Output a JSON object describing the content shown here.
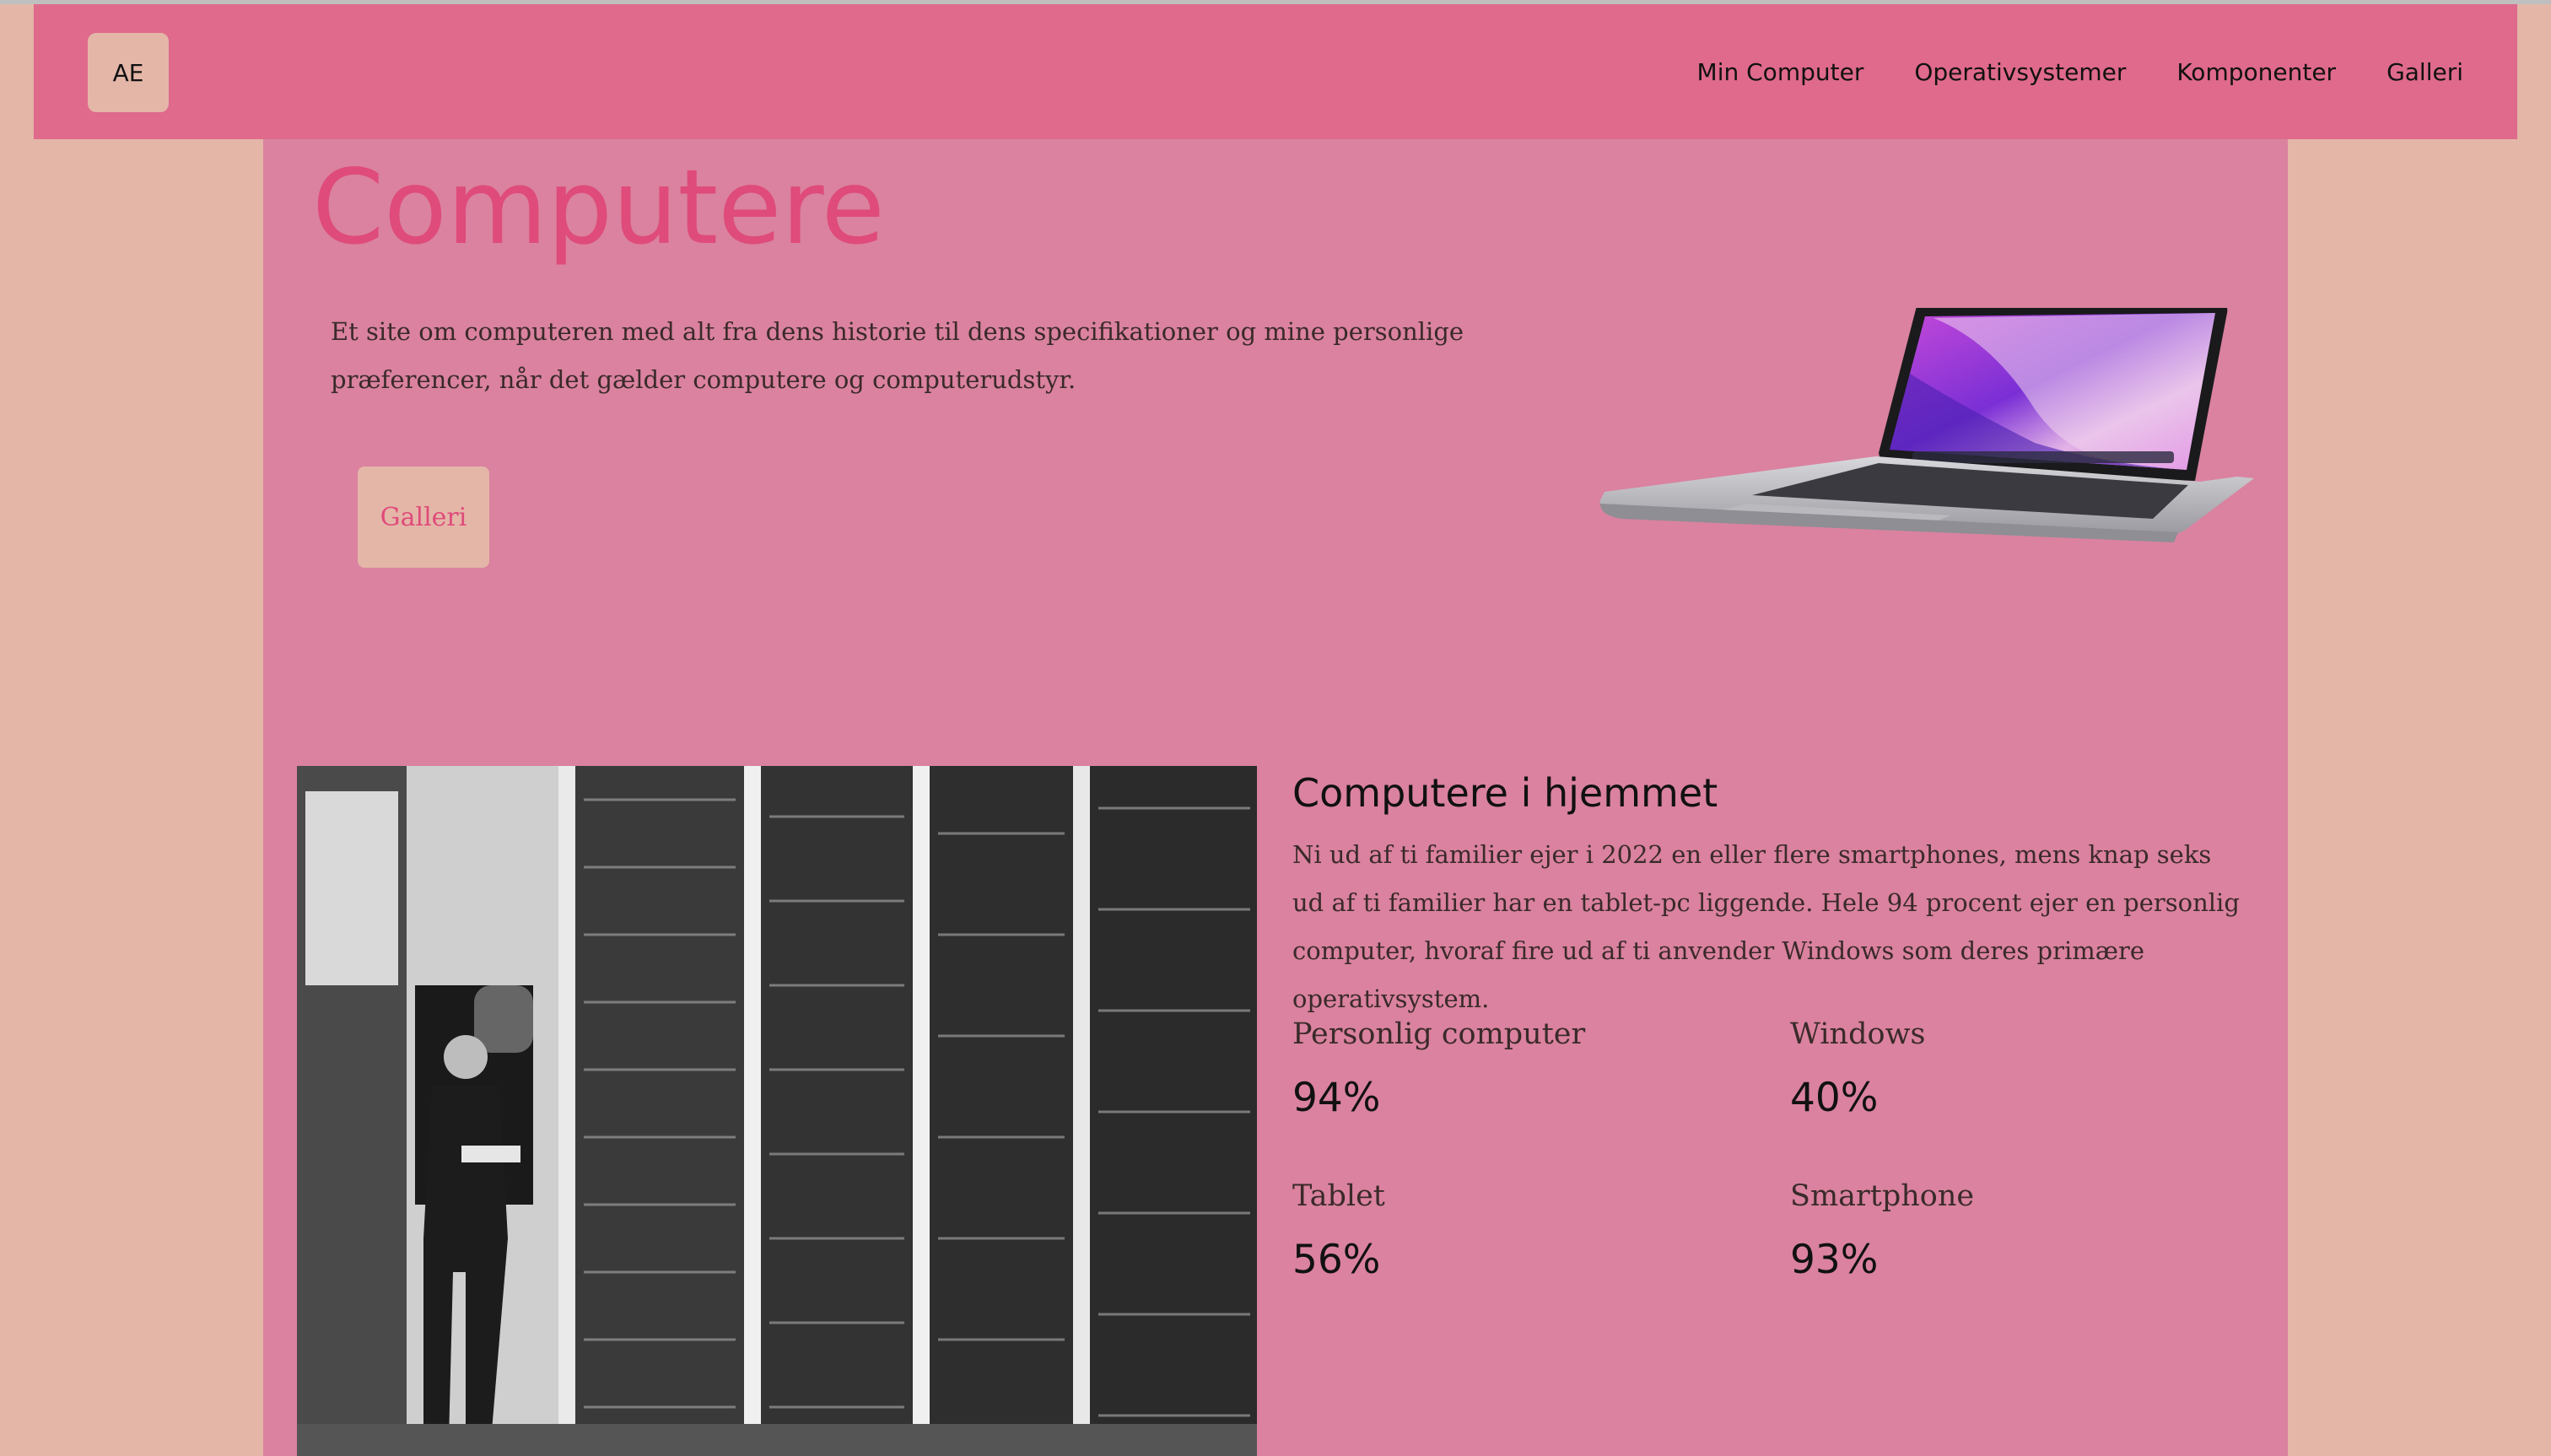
{
  "nav": {
    "logo": "AE",
    "links": [
      "Min Computer",
      "Operativsystemer",
      "Komponenter",
      "Galleri"
    ]
  },
  "hero": {
    "title": "Computere",
    "intro": "Et site om computeren med alt fra dens historie til dens specifikationer og mine personlige præferencer, når det gælder computere og computerudstyr.",
    "button_label": "Galleri"
  },
  "home": {
    "title": "Computere i hjemmet",
    "text": "Ni ud af ti familier ejer i 2022 en eller flere smartphones, mens knap seks ud af ti familier har en tablet-pc liggende. Hele 94 procent ejer en personlig computer, hvoraf fire ud af ti anvender Windows som deres primære operativsystem.",
    "stats": [
      {
        "label": "Personlig computer",
        "value": "94%"
      },
      {
        "label": "Windows",
        "value": "40%"
      },
      {
        "label": "Tablet",
        "value": "56%"
      },
      {
        "label": "Smartphone",
        "value": "93%"
      }
    ]
  },
  "colors": {
    "page_background": "#e4b6a8",
    "navbar": "#df6a8b",
    "content_background": "#da829f",
    "title_accent": "#df4b7a"
  }
}
